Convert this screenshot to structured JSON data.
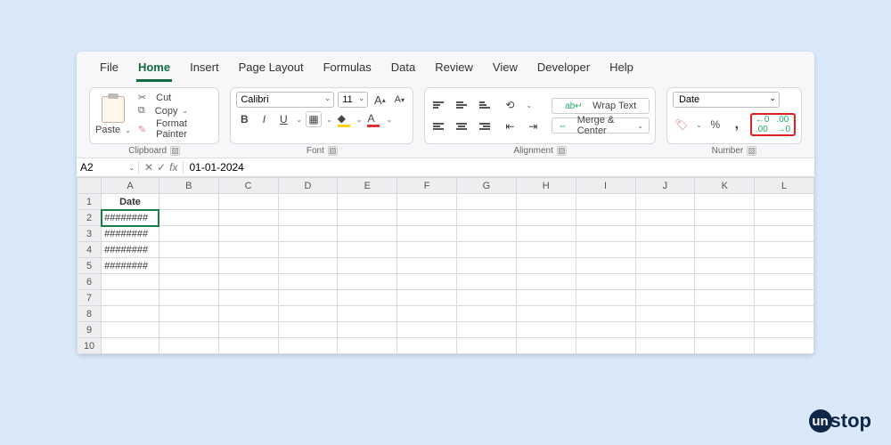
{
  "tabs": [
    "File",
    "Home",
    "Insert",
    "Page Layout",
    "Formulas",
    "Data",
    "Review",
    "View",
    "Developer",
    "Help"
  ],
  "active_tab": "Home",
  "clipboard": {
    "paste": "Paste",
    "cut": "Cut",
    "copy": "Copy",
    "painter": "Format Painter",
    "label": "Clipboard"
  },
  "font": {
    "name": "Calibri",
    "size": "11",
    "label": "Font"
  },
  "alignment": {
    "wrap": "Wrap Text",
    "merge": "Merge & Center",
    "label": "Alignment"
  },
  "number": {
    "format": "Date",
    "label": "Number"
  },
  "namebox": "A2",
  "formula": "01-01-2024",
  "columns": [
    "A",
    "B",
    "C",
    "D",
    "E",
    "F",
    "G",
    "H",
    "I",
    "J",
    "K",
    "L"
  ],
  "rows": [
    {
      "n": "1",
      "cells": [
        "Date",
        "",
        "",
        "",
        "",
        "",
        "",
        "",
        "",
        "",
        "",
        ""
      ]
    },
    {
      "n": "2",
      "cells": [
        "########",
        "",
        "",
        "",
        "",
        "",
        "",
        "",
        "",
        "",
        "",
        ""
      ]
    },
    {
      "n": "3",
      "cells": [
        "########",
        "",
        "",
        "",
        "",
        "",
        "",
        "",
        "",
        "",
        "",
        ""
      ]
    },
    {
      "n": "4",
      "cells": [
        "########",
        "",
        "",
        "",
        "",
        "",
        "",
        "",
        "",
        "",
        "",
        ""
      ]
    },
    {
      "n": "5",
      "cells": [
        "########",
        "",
        "",
        "",
        "",
        "",
        "",
        "",
        "",
        "",
        "",
        ""
      ]
    },
    {
      "n": "6",
      "cells": [
        "",
        "",
        "",
        "",
        "",
        "",
        "",
        "",
        "",
        "",
        "",
        ""
      ]
    },
    {
      "n": "7",
      "cells": [
        "",
        "",
        "",
        "",
        "",
        "",
        "",
        "",
        "",
        "",
        "",
        ""
      ]
    },
    {
      "n": "8",
      "cells": [
        "",
        "",
        "",
        "",
        "",
        "",
        "",
        "",
        "",
        "",
        "",
        ""
      ]
    },
    {
      "n": "9",
      "cells": [
        "",
        "",
        "",
        "",
        "",
        "",
        "",
        "",
        "",
        "",
        "",
        ""
      ]
    },
    {
      "n": "10",
      "cells": [
        "",
        "",
        "",
        "",
        "",
        "",
        "",
        "",
        "",
        "",
        "",
        ""
      ]
    }
  ],
  "selected": {
    "row": "2",
    "col": "A"
  },
  "logo": {
    "initial": "un",
    "rest": "stop"
  }
}
